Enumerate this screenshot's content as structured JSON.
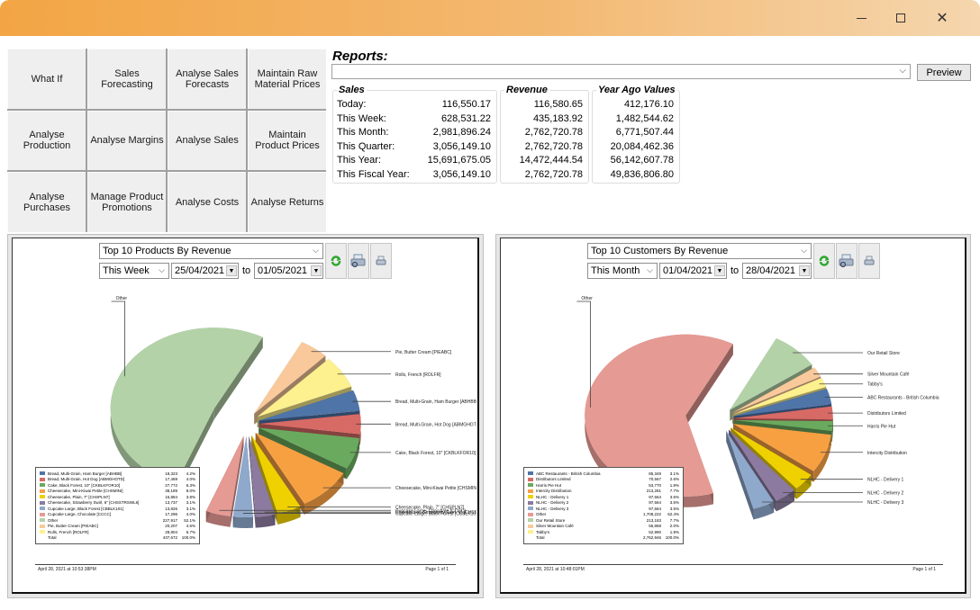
{
  "window": {
    "controls": {
      "minimize": "minimize",
      "maximize": "maximize",
      "close": "close"
    }
  },
  "nav": {
    "buttons": [
      "What If",
      "Sales Forecasting",
      "Analyse Sales Forecasts",
      "Maintain Raw Material Prices",
      "Analyse Production",
      "Analyse Margins",
      "Analyse Sales",
      "Maintain Product Prices",
      "Analyse Purchases",
      "Manage Product Promotions",
      "Analyse Costs",
      "Analyse Returns"
    ]
  },
  "reports": {
    "title": "Reports:",
    "selected": "",
    "preview_label": "Preview"
  },
  "summary": {
    "sales": {
      "header": "Sales",
      "rows": [
        {
          "label": "Today:",
          "value": "116,550.17"
        },
        {
          "label": "This Week:",
          "value": "628,531.22"
        },
        {
          "label": "This Month:",
          "value": "2,981,896.24"
        },
        {
          "label": "This Quarter:",
          "value": "3,056,149.10"
        },
        {
          "label": "This Year:",
          "value": "15,691,675.05"
        },
        {
          "label": "This Fiscal Year:",
          "value": "3,056,149.10"
        }
      ]
    },
    "revenue": {
      "header": "Revenue",
      "values": [
        "116,580.65",
        "435,183.92",
        "2,762,720.78",
        "2,762,720.78",
        "14,472,444.54",
        "2,762,720.78"
      ]
    },
    "year_ago": {
      "header": "Year Ago Values",
      "values": [
        "412,176.10",
        "1,482,544.62",
        "6,771,507.44",
        "20,084,462.36",
        "56,142,607.78",
        "49,836,806.80"
      ]
    }
  },
  "panels": [
    {
      "report": "Top 10 Products By Revenue",
      "period": "This Week",
      "date_from": "25/04/2021",
      "to_label": "to",
      "date_to": "01/05/2021",
      "footer_left": "April 28, 2021 at 10:53:38PM",
      "footer_right": "Page 1 of 1"
    },
    {
      "report": "Top 10 Customers By Revenue",
      "period": "This Month",
      "date_from": "01/04/2021",
      "to_label": "to",
      "date_to": "28/04/2021",
      "footer_left": "April 28, 2021 at 10:48:01PM",
      "footer_right": "Page 1 of 1"
    }
  ],
  "chart_data": [
    {
      "type": "pie",
      "title": "Top 10 Products By Revenue",
      "legend": "bottom-left",
      "slices": [
        {
          "label": "Bread, Multi-Grain, Ham Burger [ABHBB]",
          "value": 18323,
          "pct": "4.2%",
          "color": "#4f74a8"
        },
        {
          "label": "Bread, Multi-Grain, Hot Dog [ABMGHOTD]",
          "value": 17469,
          "pct": "4.0%",
          "color": "#d86a66"
        },
        {
          "label": "Cake, Black Forest, 10\" [CKBLKFOR10]",
          "value": 27772,
          "pct": "6.3%",
          "color": "#6aaa5e"
        },
        {
          "label": "Cheesecake, Mini-Kiwai Petite [CHSMINI]",
          "value": 38189,
          "pct": "8.0%",
          "color": "#f7a042"
        },
        {
          "label": "Cheesecake, Plain, 7\" [CHSPLN7]",
          "value": 16884,
          "pct": "3.8%",
          "color": "#efd100"
        },
        {
          "label": "Cheesecake, Strawberry Swirl, 6\" [CHSSTRSWL6]",
          "value": 13737,
          "pct": "3.1%",
          "color": "#8c7aa0"
        },
        {
          "label": "Cupcake Large, Black Forest [CBBLK101]",
          "value": 13826,
          "pct": "3.1%",
          "color": "#8fa9cd"
        },
        {
          "label": "Cupcake Large, Chocolate [CCCC]",
          "value": 17296,
          "pct": "4.0%",
          "color": "#e69a94"
        },
        {
          "label": "Other",
          "value": 227917,
          "pct": "52.1%",
          "color": "#b3d2a8"
        },
        {
          "label": "Pie, Butter Cream [PIEABC]",
          "value": 20207,
          "pct": "4.6%",
          "color": "#f9c99b"
        },
        {
          "label": "Rolls, French [ROLFR]",
          "value": 28804,
          "pct": "6.7%",
          "color": "#fdf08e"
        }
      ],
      "total_label": "Total",
      "total_value": "437,672",
      "total_pct": "100.0%"
    },
    {
      "type": "pie",
      "title": "Top 10 Customers By Revenue",
      "legend": "bottom-left",
      "slices": [
        {
          "label": "ABC Restaurants - British Columbia",
          "value": 85349,
          "pct": "3.1%",
          "color": "#4f74a8"
        },
        {
          "label": "Distributors Limited",
          "value": 70567,
          "pct": "2.6%",
          "color": "#d86a66"
        },
        {
          "label": "Harris Pie Hut",
          "value": 53770,
          "pct": "1.9%",
          "color": "#6aaa5e"
        },
        {
          "label": "Intercity Distribution",
          "value": 213281,
          "pct": "7.7%",
          "color": "#f7a042"
        },
        {
          "label": "NLHC - Delivery 1",
          "value": 97564,
          "pct": "3.5%",
          "color": "#efd100"
        },
        {
          "label": "NLHC - Delivery 2",
          "value": 97564,
          "pct": "3.5%",
          "color": "#8c7aa0"
        },
        {
          "label": "NLHC - Delivery 3",
          "value": 97564,
          "pct": "3.5%",
          "color": "#8fa9cd"
        },
        {
          "label": "Other",
          "value": 1708222,
          "pct": "62.4%",
          "color": "#e69a94"
        },
        {
          "label": "Our Retail Store",
          "value": 213183,
          "pct": "7.7%",
          "color": "#b3d2a8"
        },
        {
          "label": "Silver Mountain Café",
          "value": 55868,
          "pct": "2.0%",
          "color": "#f9c99b"
        },
        {
          "label": "Tabby's",
          "value": 52990,
          "pct": "1.9%",
          "color": "#fdf08e"
        }
      ],
      "total_label": "Total",
      "total_value": "2,762,946",
      "total_pct": "100.0%"
    }
  ]
}
